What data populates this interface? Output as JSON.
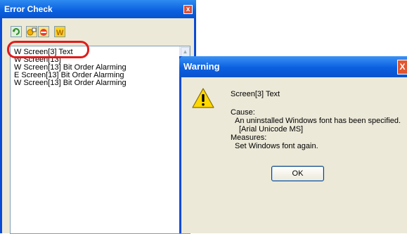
{
  "error_panel": {
    "title": "Error Check",
    "close_glyph": "x",
    "toolbar_icons": [
      "refresh-icon",
      "alarm-filter-icon",
      "error-filter-icon",
      "warning-filter-icon"
    ],
    "items": [
      "W Screen[3] Text",
      "W Screen[13]",
      "W Screen[13] Bit Order Alarming",
      "E Screen[13] Bit Order Alarming",
      "W Screen[13] Bit Order Alarming"
    ]
  },
  "warning_dialog": {
    "title": "Warning",
    "close_glyph": "X",
    "subject": "Screen[3] Text",
    "cause_label": "Cause:",
    "cause_text": "An uninstalled Windows font has been specified.",
    "font_name": "[Arial Unicode MS]",
    "measures_label": "Measures:",
    "measures_text": "Set Windows font again.",
    "ok_label": "OK"
  },
  "colors": {
    "title_bar": "#0b5fe0",
    "window_face": "#ece9d8",
    "highlight": "#e01b1b",
    "close_button": "#d9523b"
  }
}
